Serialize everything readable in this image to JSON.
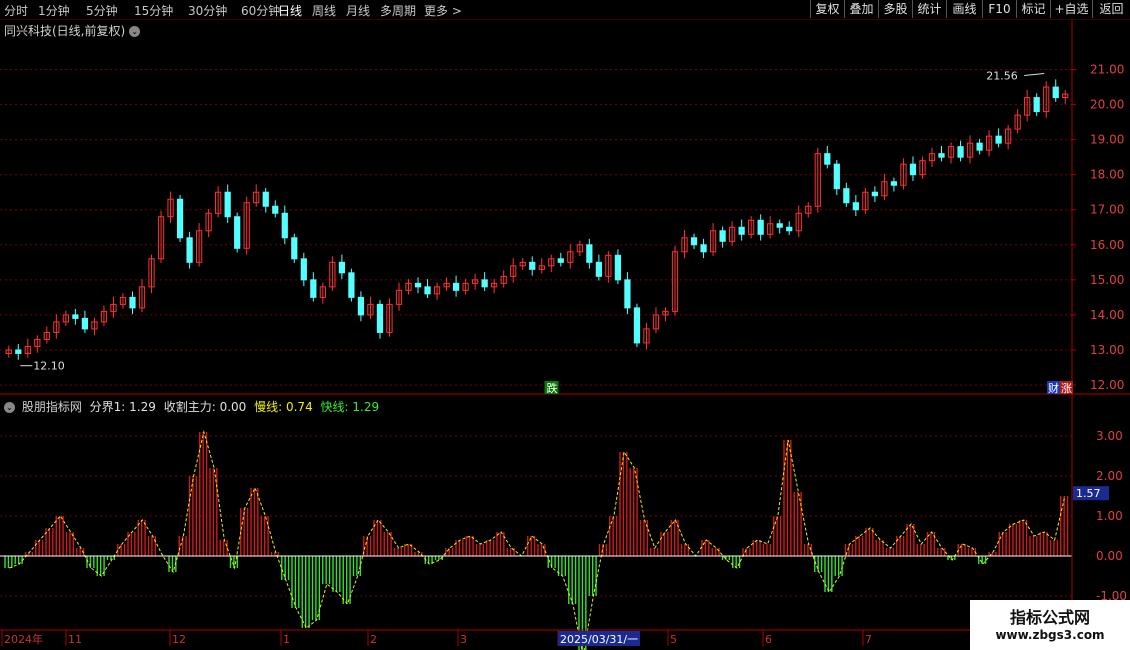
{
  "toolbar": {
    "timeframes": [
      "分时",
      "1分钟",
      "5分钟",
      "15分钟",
      "30分钟",
      "60分钟",
      "日线",
      "周线",
      "月线",
      "多周期",
      "更多 >"
    ],
    "active_timeframe": "日线",
    "right_buttons": [
      "复权",
      "叠加",
      "多股",
      "统计",
      "画线",
      "F10",
      "标记",
      "+自选",
      "返回"
    ]
  },
  "main_chart": {
    "title": "同兴科技(日线,前复权)",
    "price_ticks": [
      "21.00",
      "20.00",
      "19.00",
      "18.00",
      "17.00",
      "16.00",
      "15.00",
      "14.00",
      "13.00",
      "12.00"
    ],
    "high_label": "21.56",
    "low_label": "12.10",
    "marker_die": "跌",
    "marker_cai": "财",
    "marker_zhang": "涨"
  },
  "indicator": {
    "name": "股朋指标网",
    "fenjie_label": "分界1: 1.29",
    "shouge_label": "收割主力: 0.00",
    "manxian_label": "慢线: 0.74",
    "kuaixian_label": "快线: 1.29",
    "value_ticks": [
      "3.00",
      "2.00",
      "1.00",
      "0.00",
      "-1.00"
    ],
    "current_value": "1.57"
  },
  "date_axis": {
    "labels": [
      "2024年",
      "11",
      "12",
      "1",
      "2",
      "3",
      "2025/03/31/一",
      "5",
      "6",
      "7"
    ]
  },
  "watermark": {
    "line1": "指标公式网",
    "line2": "www.zbgs3.com"
  },
  "colors": {
    "up": "#ff3232",
    "down": "#54ffff",
    "bar_up": "#d41a1a",
    "bar_down": "#33e233",
    "grid": "#7a0000",
    "axis": "#b00000",
    "slow_line": "#f0f000",
    "fast_line": "#33ee33"
  },
  "chart_data": [
    {
      "type": "candlestick",
      "title": "同兴科技(日线,前复权)",
      "x_start": "2024-10",
      "y_range": [
        11.8,
        21.9
      ],
      "closes": [
        13.0,
        12.9,
        13.1,
        13.3,
        13.5,
        13.8,
        14.0,
        13.9,
        13.6,
        13.8,
        14.1,
        14.3,
        14.5,
        14.2,
        14.8,
        15.6,
        16.8,
        17.3,
        16.2,
        15.5,
        16.4,
        16.9,
        17.5,
        16.8,
        15.9,
        17.2,
        17.5,
        17.1,
        16.9,
        16.2,
        15.6,
        15.0,
        14.5,
        14.8,
        15.5,
        15.2,
        14.5,
        14.0,
        14.3,
        13.5,
        14.3,
        14.7,
        14.9,
        14.8,
        14.6,
        14.8,
        14.9,
        14.7,
        14.9,
        15.0,
        14.8,
        14.9,
        15.1,
        15.4,
        15.5,
        15.3,
        15.4,
        15.6,
        15.5,
        15.8,
        16.0,
        15.5,
        15.1,
        15.7,
        15.0,
        14.2,
        13.2,
        13.6,
        14.0,
        14.1,
        15.8,
        16.2,
        16.0,
        15.8,
        16.4,
        16.1,
        16.5,
        16.3,
        16.7,
        16.3,
        16.6,
        16.5,
        16.4,
        16.9,
        17.1,
        18.6,
        18.3,
        17.6,
        17.2,
        17.0,
        17.5,
        17.4,
        17.8,
        17.7,
        18.3,
        18.0,
        18.4,
        18.6,
        18.5,
        18.8,
        18.5,
        18.9,
        18.7,
        19.1,
        18.9,
        19.3,
        19.7,
        20.2,
        19.8,
        20.5,
        20.2,
        20.3
      ]
    },
    {
      "type": "bar",
      "title": "股朋指标网",
      "y_range": [
        -1.8,
        3.6
      ],
      "series": [
        {
          "name": "快线",
          "values": [
            -0.3,
            -0.2,
            0.1,
            0.4,
            0.7,
            1.0,
            0.6,
            0.2,
            -0.3,
            -0.5,
            -0.1,
            0.3,
            0.6,
            0.9,
            0.5,
            0.0,
            -0.4,
            0.5,
            2.0,
            3.1,
            2.2,
            0.4,
            -0.3,
            1.2,
            1.7,
            1.0,
            0.1,
            -0.6,
            -1.3,
            -1.8,
            -1.6,
            -0.7,
            -0.9,
            -1.2,
            -0.5,
            0.5,
            0.9,
            0.6,
            0.2,
            0.3,
            0.1,
            -0.2,
            -0.1,
            0.2,
            0.4,
            0.5,
            0.3,
            0.4,
            0.6,
            0.2,
            0.0,
            0.5,
            0.3,
            -0.3,
            -0.5,
            -1.2,
            -2.5,
            -1.0,
            0.3,
            1.0,
            2.6,
            2.2,
            0.9,
            0.2,
            0.6,
            0.9,
            0.3,
            0.0,
            0.4,
            0.2,
            -0.1,
            -0.3,
            0.2,
            0.4,
            0.3,
            1.0,
            2.9,
            1.6,
            0.3,
            -0.4,
            -0.9,
            -0.5,
            0.3,
            0.5,
            0.7,
            0.4,
            0.2,
            0.5,
            0.8,
            0.3,
            0.6,
            0.2,
            -0.1,
            0.3,
            0.2,
            -0.2,
            0.1,
            0.6,
            0.8,
            0.9,
            0.5,
            0.6,
            0.4,
            1.5
          ]
        }
      ]
    }
  ]
}
